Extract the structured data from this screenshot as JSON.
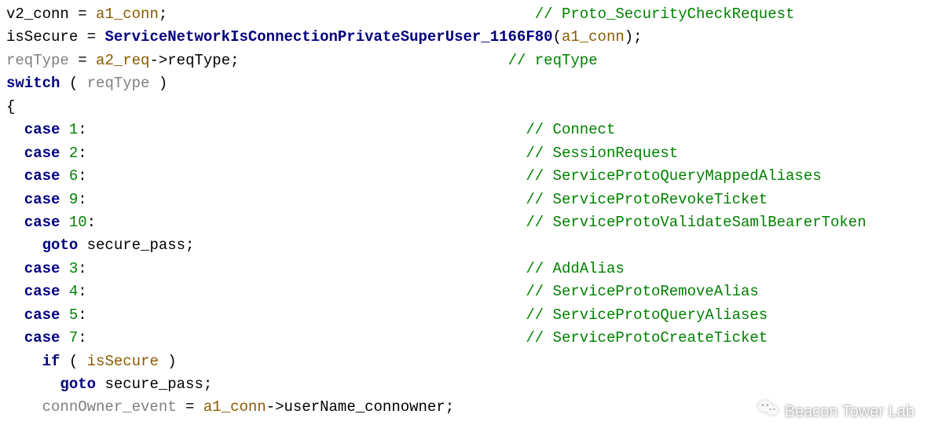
{
  "code": {
    "l1_a": "v2_conn",
    "l1_b": " = ",
    "l1_c": "a1_conn",
    "l1_d": ";",
    "l1_pad": "                                         ",
    "l1_cmt": "// Proto_SecurityCheckRequest",
    "l2_a": "isSecure",
    "l2_b": " = ",
    "l2_c": "ServiceNetworkIsConnectionPrivateSuperUser_1166F80",
    "l2_d": "(",
    "l2_e": "a1_conn",
    "l2_f": ");",
    "l3_a": "reqType",
    "l3_b": " = ",
    "l3_c": "a2_req",
    "l3_d": "->",
    "l3_e": "reqType",
    "l3_f": ";",
    "l3_pad": "                              ",
    "l3_cmt": "// reqType",
    "l4_a": "switch",
    "l4_b": " ( ",
    "l4_c": "reqType",
    "l4_d": " )",
    "l5": "{",
    "l6_a": "  case",
    "l6_b": " ",
    "l6_c": "1",
    "l6_d": ":",
    "l6_pad": "                                                 ",
    "l6_cmt": "// Connect",
    "l7_a": "  case",
    "l7_b": " ",
    "l7_c": "2",
    "l7_d": ":",
    "l7_pad": "                                                 ",
    "l7_cmt": "// SessionRequest",
    "l8_a": "  case",
    "l8_b": " ",
    "l8_c": "6",
    "l8_d": ":",
    "l8_pad": "                                                 ",
    "l8_cmt": "// ServiceProtoQueryMappedAliases",
    "l9_a": "  case",
    "l9_b": " ",
    "l9_c": "9",
    "l9_d": ":",
    "l9_pad": "                                                 ",
    "l9_cmt": "// ServiceProtoRevokeTicket",
    "l10_a": "  case",
    "l10_b": " ",
    "l10_c": "10",
    "l10_d": ":",
    "l10_pad": "                                                ",
    "l10_cmt": "// ServiceProtoValidateSamlBearerToken",
    "l11_a": "    goto",
    "l11_b": " ",
    "l11_c": "secure_pass",
    "l11_d": ";",
    "l12_a": "  case",
    "l12_b": " ",
    "l12_c": "3",
    "l12_d": ":",
    "l12_pad": "                                                 ",
    "l12_cmt": "// AddAlias",
    "l13_a": "  case",
    "l13_b": " ",
    "l13_c": "4",
    "l13_d": ":",
    "l13_pad": "                                                 ",
    "l13_cmt": "// ServiceProtoRemoveAlias",
    "l14_a": "  case",
    "l14_b": " ",
    "l14_c": "5",
    "l14_d": ":",
    "l14_pad": "                                                 ",
    "l14_cmt": "// ServiceProtoQueryAliases",
    "l15_a": "  case",
    "l15_b": " ",
    "l15_c": "7",
    "l15_d": ":",
    "l15_pad": "                                                 ",
    "l15_cmt": "// ServiceProtoCreateTicket",
    "l16_a": "    if",
    "l16_b": " ( ",
    "l16_c": "isSecure",
    "l16_d": " )",
    "l17_a": "      goto",
    "l17_b": " ",
    "l17_c": "secure_pass",
    "l17_d": ";",
    "l18_a": "    ",
    "l18_b": "connOwner_event",
    "l18_c": " = ",
    "l18_d": "a1_conn",
    "l18_e": "->",
    "l18_f": "userName_connowner",
    "l18_g": ";"
  },
  "watermark": {
    "text": "Beacon Tower Lab"
  }
}
